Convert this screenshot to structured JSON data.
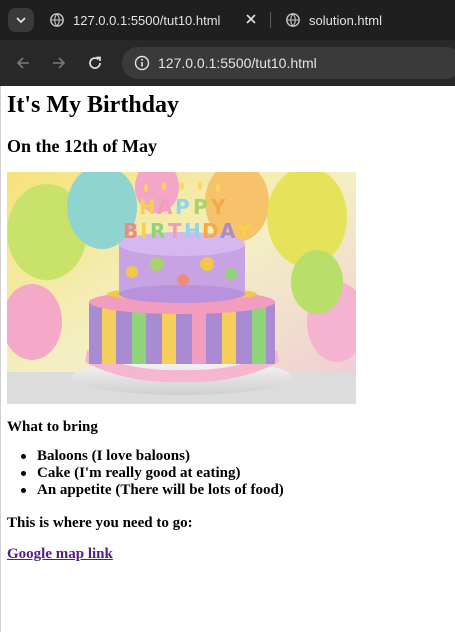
{
  "browser": {
    "tabs": [
      {
        "title": "127.0.0.1:5500/tut10.html",
        "active": true
      },
      {
        "title": "solution.html",
        "active": false
      }
    ],
    "address": "127.0.0.1:5500/tut10.html",
    "icons": [
      "tab-list-icon",
      "globe-icon",
      "close-icon",
      "back-icon",
      "forward-icon",
      "reload-icon",
      "info-icon"
    ]
  },
  "page": {
    "heading": "It's My Birthday",
    "subheading": "On the 12th of May",
    "image_text": "HAPPY BIRTHDAY",
    "bring_label": "What to bring",
    "items": [
      "Baloons (I love baloons)",
      "Cake (I'm really good at eating)",
      "An appetite (There will be lots of food)"
    ],
    "where_label": "This is where you need to go:",
    "map_link": "Google map link"
  },
  "colors": {
    "chrome_bg": "#1f1f1f",
    "toolbar_bg": "#282828",
    "omnibox_bg": "#3a3a3a",
    "visited_link": "#551a8b"
  }
}
